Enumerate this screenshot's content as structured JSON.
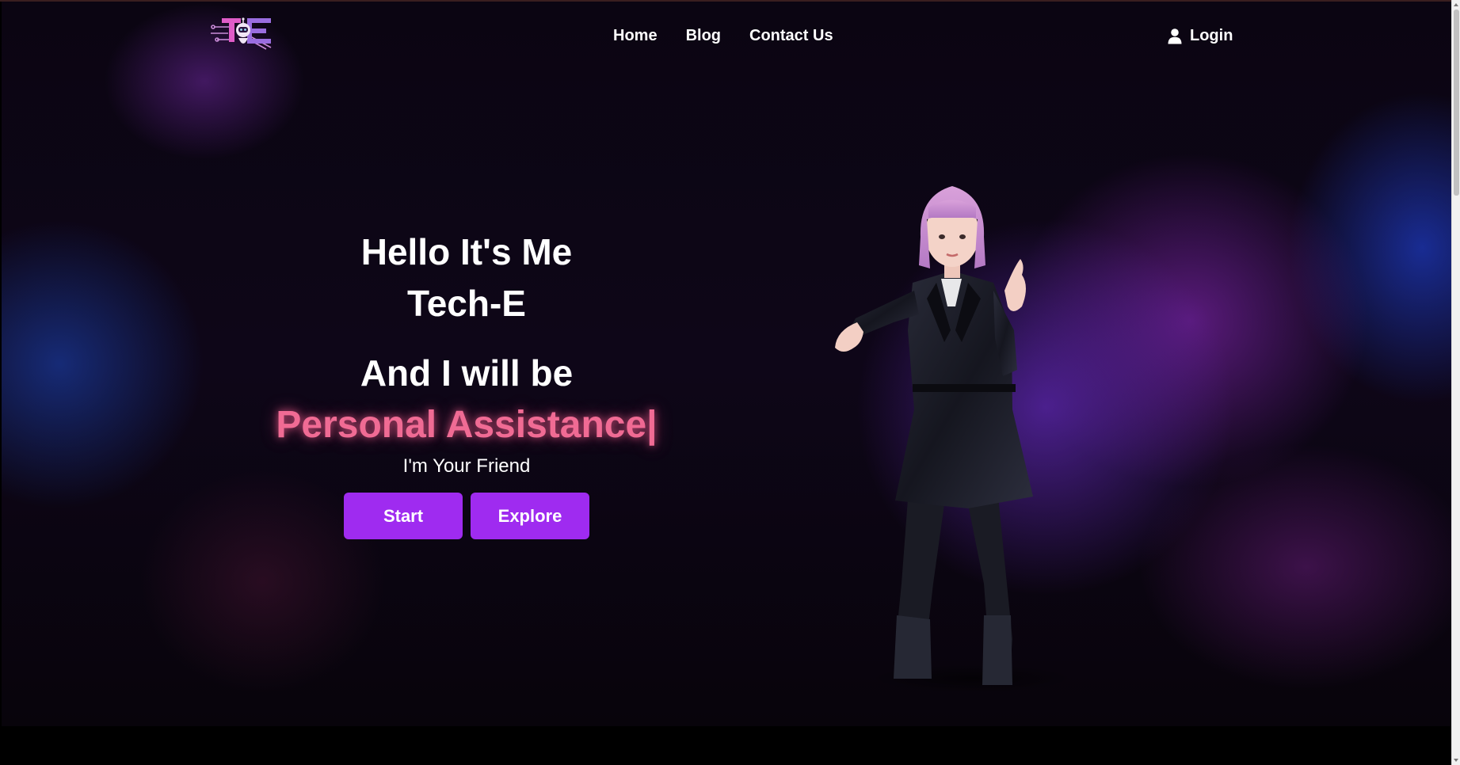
{
  "nav": {
    "logo_alt": "Tech-E logo",
    "links": [
      "Home",
      "Blog",
      "Contact Us"
    ],
    "login_label": "Login"
  },
  "hero": {
    "greeting_line1": "Hello It's Me",
    "greeting_line2": "Tech-E",
    "tagline": "And I will be",
    "typed_text": "Personal Assistance",
    "typed_cursor": "|",
    "subtitle": "I'm Your Friend",
    "start_label": "Start",
    "explore_label": "Explore"
  },
  "icons": {
    "login": "user-icon",
    "logo": "robot-circuit-logo"
  },
  "colors": {
    "accent_button": "#9f2bf0",
    "typed_text": "#f06b94",
    "text": "#ffffff"
  }
}
